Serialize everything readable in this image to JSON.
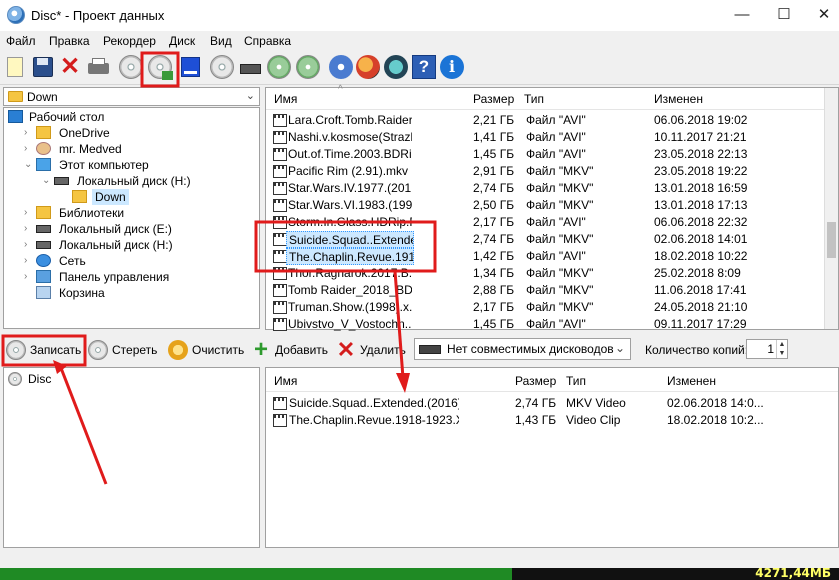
{
  "window": {
    "title": "Disc* - Проект данных",
    "controls": {
      "minimize": "—",
      "maximize": "☐",
      "close": "✕"
    }
  },
  "menu": [
    "Файл",
    "Правка",
    "Рекордер",
    "Диск",
    "Вид",
    "Справка"
  ],
  "source": {
    "folder_dropdown": "Down",
    "tree": [
      {
        "label": "Рабочий стол",
        "icon": "desktop-icon",
        "indent": 0,
        "arrow": ""
      },
      {
        "label": "OneDrive",
        "icon": "cloud-folder-icon",
        "indent": 1,
        "arrow": "›"
      },
      {
        "label": "mr. Medved",
        "icon": "user-icon",
        "indent": 1,
        "arrow": "›"
      },
      {
        "label": "Этот компьютер",
        "icon": "computer-icon",
        "indent": 1,
        "arrow": "⌄"
      },
      {
        "label": "Локальный диск (H:)",
        "icon": "drive-icon",
        "indent": 2,
        "arrow": "⌄"
      },
      {
        "label": "Down",
        "icon": "folder-icon",
        "indent": 3,
        "arrow": "",
        "selected": true
      },
      {
        "label": "Библиотеки",
        "icon": "library-icon",
        "indent": 1,
        "arrow": "›"
      },
      {
        "label": "Локальный диск (E:)",
        "icon": "drive-icon",
        "indent": 1,
        "arrow": "›"
      },
      {
        "label": "Локальный диск (H:)",
        "icon": "drive-icon",
        "indent": 1,
        "arrow": "›"
      },
      {
        "label": "Сеть",
        "icon": "network-icon",
        "indent": 1,
        "arrow": "›"
      },
      {
        "label": "Панель управления",
        "icon": "control-panel-icon",
        "indent": 1,
        "arrow": "›"
      },
      {
        "label": "Корзина",
        "icon": "recycle-bin-icon",
        "indent": 1,
        "arrow": ""
      }
    ],
    "columns": [
      "Имя",
      "Размер",
      "Тип",
      "Изменен"
    ],
    "files": [
      {
        "name": "Lara.Croft.Tomb.Raider....",
        "size": "2,21 ГБ",
        "type": "Файл \"AVI\"",
        "modified": "06.06.2018 19:02"
      },
      {
        "name": "Nashi.v.kosmose(Strazh...",
        "size": "1,41 ГБ",
        "type": "Файл \"AVI\"",
        "modified": "10.11.2017 21:21"
      },
      {
        "name": "Out.of.Time.2003.BDRip...",
        "size": "1,45 ГБ",
        "type": "Файл \"AVI\"",
        "modified": "23.05.2018 22:13"
      },
      {
        "name": "Pacific Rim (2.91).mkv",
        "size": "2,91 ГБ",
        "type": "Файл \"MKV\"",
        "modified": "23.05.2018 19:22"
      },
      {
        "name": "Star.Wars.IV.1977.(201...",
        "size": "2,74 ГБ",
        "type": "Файл \"MKV\"",
        "modified": "13.01.2018 16:59"
      },
      {
        "name": "Star.Wars.VI.1983.(199...",
        "size": "2,50 ГБ",
        "type": "Файл \"MKV\"",
        "modified": "13.01.2018 17:13"
      },
      {
        "name": "Storm.In.Glass.HDRip.R...",
        "size": "2,17 ГБ",
        "type": "Файл \"AVI\"",
        "modified": "06.06.2018 22:32"
      },
      {
        "name": "Suicide.Squad..Extende...",
        "size": "2,74 ГБ",
        "type": "Файл \"MKV\"",
        "modified": "02.06.2018 14:01",
        "selected": true
      },
      {
        "name": "The.Chaplin.Revue.191...",
        "size": "1,42 ГБ",
        "type": "Файл \"AVI\"",
        "modified": "18.02.2018 10:22",
        "selected": true
      },
      {
        "name": "Thor.Ragnarok.2017.B...",
        "size": "1,34 ГБ",
        "type": "Файл \"MKV\"",
        "modified": "25.02.2018 8:09"
      },
      {
        "name": "Tomb Raider_2018_BD...",
        "size": "2,88 ГБ",
        "type": "Файл \"MKV\"",
        "modified": "11.06.2018 17:41"
      },
      {
        "name": "Truman.Show.(1998).x...",
        "size": "2,17 ГБ",
        "type": "Файл \"MKV\"",
        "modified": "24.05.2018 21:10"
      },
      {
        "name": "Ubivstvo_V_Vostochn...",
        "size": "1,45 ГБ",
        "type": "Файл \"AVI\"",
        "modified": "09.11.2017 17:29"
      }
    ]
  },
  "actions": {
    "burn": "Записать",
    "erase": "Стереть",
    "clear": "Очистить",
    "add": "Добавить",
    "remove": "Удалить",
    "drive_select": "Нет совместимых дисководов",
    "copies_label": "Количество копий:",
    "copies_value": "1"
  },
  "project": {
    "root": "Disc",
    "columns": [
      "Имя",
      "Размер",
      "Тип",
      "Изменен"
    ],
    "files": [
      {
        "name": "Suicide.Squad..Extended.(2016)....",
        "size": "2,74 ГБ",
        "type": "MKV Video",
        "modified": "02.06.2018 14:0..."
      },
      {
        "name": "The.Chaplin.Revue.1918-1923.X...",
        "size": "1,43 ГБ",
        "type": "Video Clip",
        "modified": "18.02.2018 10:2..."
      }
    ]
  },
  "status": {
    "capacity_used_fraction": 0.61,
    "capacity_text": "4271,44МБ",
    "fill_color": "#1f8a24"
  }
}
